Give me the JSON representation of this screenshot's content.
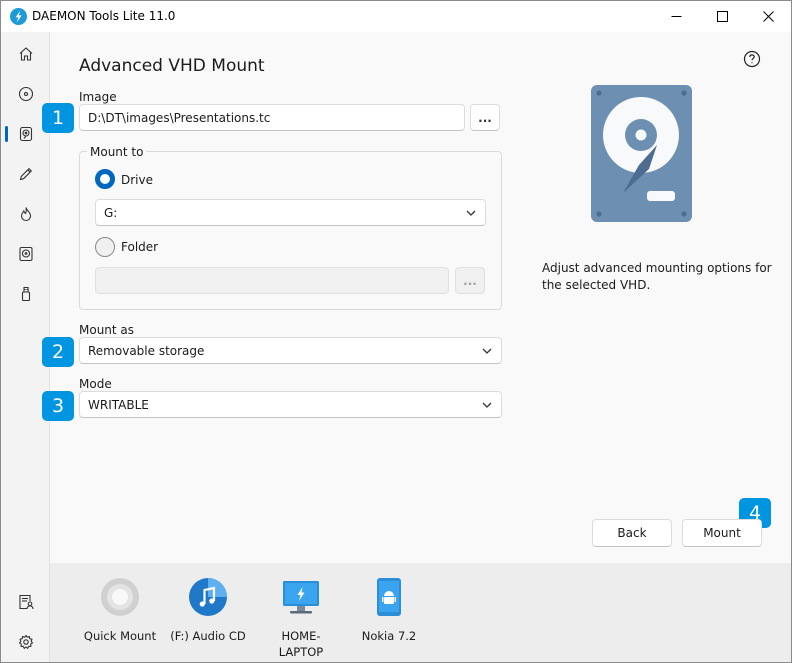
{
  "window": {
    "title": "DAEMON Tools Lite 11.0"
  },
  "sidebar": {
    "items": [
      {
        "icon": "home-icon"
      },
      {
        "icon": "disc-icon"
      },
      {
        "icon": "hdd-mount-icon",
        "active": true
      },
      {
        "icon": "pencil-icon"
      },
      {
        "icon": "flame-icon"
      },
      {
        "icon": "virtual-disk-icon"
      },
      {
        "icon": "usb-icon"
      }
    ],
    "bottom_items": [
      {
        "icon": "license-user-icon"
      },
      {
        "icon": "gear-icon"
      }
    ]
  },
  "main": {
    "title": "Advanced VHD Mount",
    "image": {
      "label": "Image",
      "value": "D:\\DT\\images\\Presentations.tc",
      "browse_label": "..."
    },
    "mount_to": {
      "caption": "Mount to",
      "drive_label": "Drive",
      "drive_selected": true,
      "drive_value": "G:",
      "folder_label": "Folder",
      "folder_selected": false,
      "folder_value": "",
      "folder_browse_label": "..."
    },
    "mount_as": {
      "label": "Mount as",
      "value": "Removable storage"
    },
    "mode": {
      "label": "Mode",
      "value": "WRITABLE"
    },
    "description": "Adjust advanced mounting options for the selected VHD.",
    "badges": [
      "1",
      "2",
      "3",
      "4"
    ],
    "buttons": {
      "back": "Back",
      "mount": "Mount"
    }
  },
  "devices": [
    {
      "name": "Quick Mount",
      "icon": "quick-mount-icon"
    },
    {
      "name": "(F:) Audio CD",
      "icon": "audio-cd-icon"
    },
    {
      "name": "HOME-LAPTOP",
      "icon": "laptop-icon"
    },
    {
      "name": "Nokia 7.2",
      "icon": "android-phone-icon"
    }
  ],
  "colors": {
    "accent": "#0067c0",
    "badge": "#0095e0",
    "hdd_body": "#6d8fb2"
  }
}
